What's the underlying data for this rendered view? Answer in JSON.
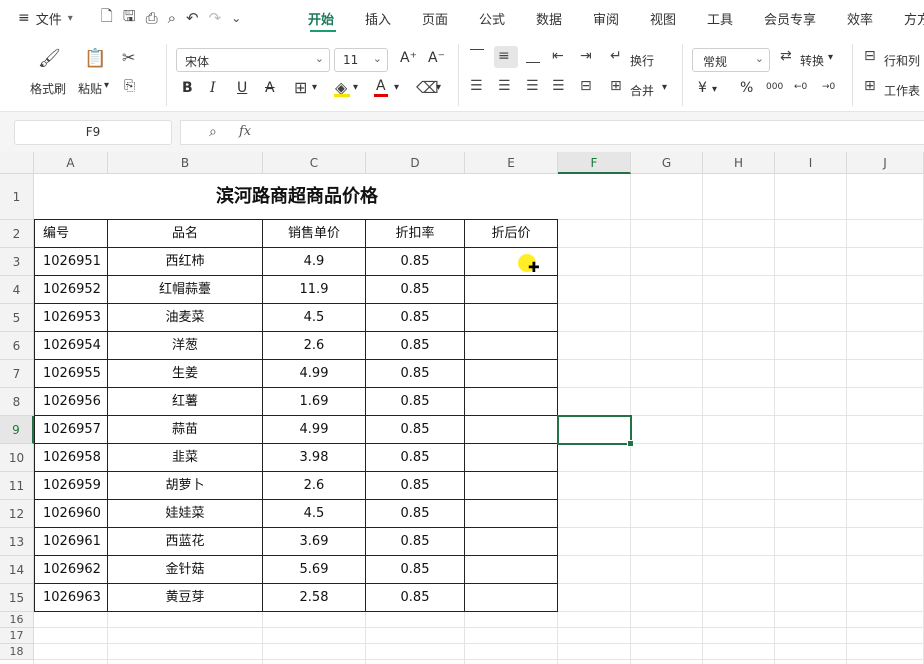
{
  "menu": {
    "menu_icon": "≡",
    "file_label": "文件",
    "tabs": [
      "开始",
      "插入",
      "页面",
      "公式",
      "数据",
      "审阅",
      "视图",
      "工具",
      "会员专享",
      "效率",
      "方方"
    ]
  },
  "ribbon": {
    "format_painter": "格式刷",
    "paste": "粘贴",
    "font_name": "宋体",
    "font_size": "11",
    "wrap": "换行",
    "merge": "合并",
    "number_format": "常规",
    "convert": "转换",
    "row_col": "行和列",
    "worksheet": "工作表",
    "bold": "B",
    "italic": "I",
    "underline": "U",
    "strike": "A",
    "grow": "A⁺",
    "shrink": "A⁻",
    "currency": "¥",
    "percent": "%",
    "thousands": "000",
    "dec_inc": "←0",
    "dec_dec": "→0"
  },
  "formula_bar": {
    "cell_ref": "F9",
    "fx": "fx",
    "content": ""
  },
  "sheet": {
    "columns": [
      "A",
      "B",
      "C",
      "D",
      "E",
      "F",
      "G",
      "H",
      "I",
      "J"
    ],
    "rows": [
      "1",
      "2",
      "3",
      "4",
      "5",
      "6",
      "7",
      "8",
      "9",
      "10",
      "11",
      "12",
      "13",
      "14",
      "15",
      "16",
      "17",
      "18"
    ],
    "selected_cell": "F9",
    "title": "滨河路商超商品价格",
    "headers": [
      "编号",
      "品名",
      "销售单价",
      "折扣率",
      "折后价"
    ],
    "data": [
      [
        "1026951",
        "西红柿",
        "4.9",
        "0.85",
        ""
      ],
      [
        "1026952",
        "红帽蒜薹",
        "11.9",
        "0.85",
        ""
      ],
      [
        "1026953",
        "油麦菜",
        "4.5",
        "0.85",
        ""
      ],
      [
        "1026954",
        "洋葱",
        "2.6",
        "0.85",
        ""
      ],
      [
        "1026955",
        "生姜",
        "4.99",
        "0.85",
        ""
      ],
      [
        "1026956",
        "红薯",
        "1.69",
        "0.85",
        ""
      ],
      [
        "1026957",
        "蒜苗",
        "4.99",
        "0.85",
        ""
      ],
      [
        "1026958",
        "韭菜",
        "3.98",
        "0.85",
        ""
      ],
      [
        "1026959",
        "胡萝卜",
        "2.6",
        "0.85",
        ""
      ],
      [
        "1026960",
        "娃娃菜",
        "4.5",
        "0.85",
        ""
      ],
      [
        "1026961",
        "西蓝花",
        "3.69",
        "0.85",
        ""
      ],
      [
        "1026962",
        "金针菇",
        "5.69",
        "0.85",
        ""
      ],
      [
        "1026963",
        "黄豆芽",
        "2.58",
        "0.85",
        ""
      ]
    ]
  },
  "colors": {
    "accent": "#1a9d6f",
    "selection": "#217346",
    "cursor": "#ffeb00"
  }
}
